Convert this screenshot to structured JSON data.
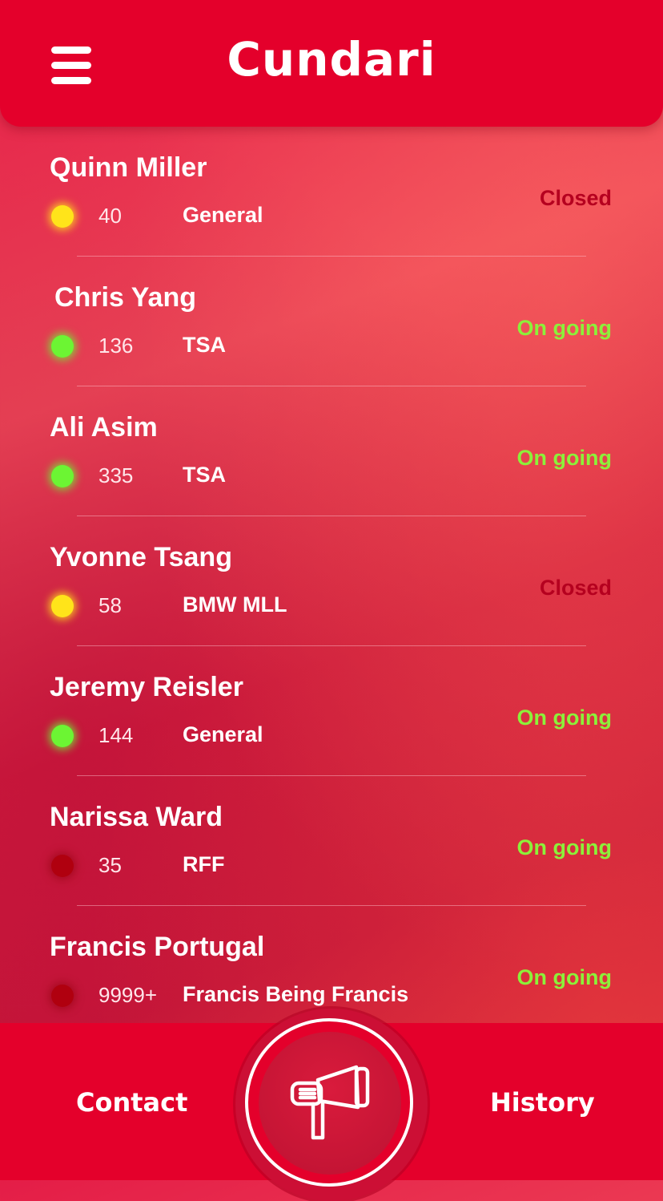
{
  "header": {
    "title": "Cundari",
    "menu_icon": "hamburger-menu-icon"
  },
  "colors": {
    "header_red": "#e4002b",
    "status_closed": "#b5001f",
    "status_ongoing": "#8cf03a",
    "dot_yellow": "#ffe41a",
    "dot_green": "#6cf533",
    "dot_red": "#b0000f"
  },
  "rows": [
    {
      "name": "Quinn Miller",
      "count": "40",
      "category": "General",
      "status": "Closed",
      "dot": "yellow"
    },
    {
      "name": "Chris Yang",
      "count": "136",
      "category": "TSA",
      "status": "On going",
      "dot": "green"
    },
    {
      "name": "Ali Asim",
      "count": "335",
      "category": "TSA",
      "status": "On going",
      "dot": "green"
    },
    {
      "name": "Yvonne Tsang",
      "count": "58",
      "category": "BMW MLL",
      "status": "Closed",
      "dot": "yellow"
    },
    {
      "name": "Jeremy Reisler",
      "count": "144",
      "category": "General",
      "status": "On going",
      "dot": "green"
    },
    {
      "name": "Narissa Ward",
      "count": "35",
      "category": "RFF",
      "status": "On going",
      "dot": "red"
    },
    {
      "name": "Francis Portugal",
      "count": "9999+",
      "category": "Francis Being Francis",
      "status": "On going",
      "dot": "red"
    }
  ],
  "bottom_nav": {
    "contact_label": "Contact",
    "history_label": "History",
    "center_icon": "megaphone-icon"
  }
}
